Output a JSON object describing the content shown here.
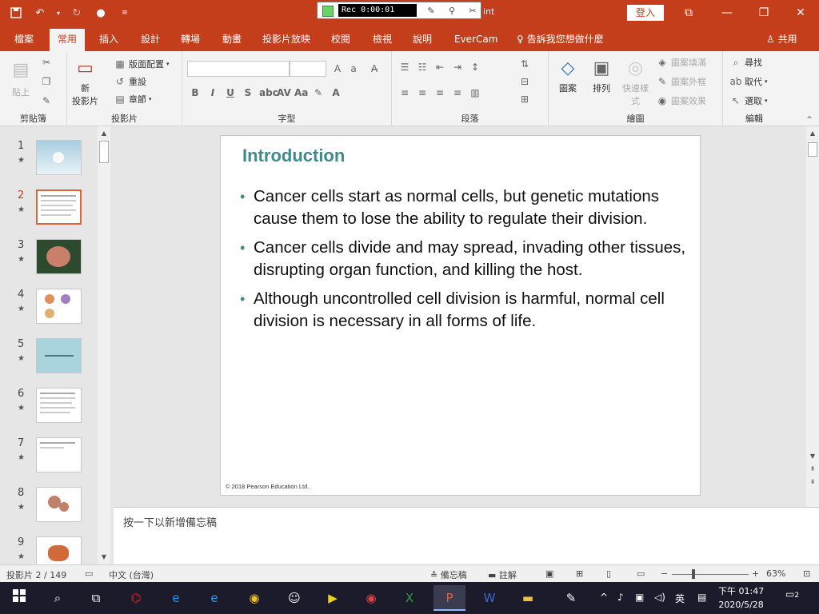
{
  "titlebar": {
    "rec_time": "Rec 0:00:01",
    "app_title": "int",
    "signin_label": "登入",
    "colors": {
      "accent": "#c43e1c"
    }
  },
  "menu": {
    "tabs": [
      "檔案",
      "常用",
      "插入",
      "設計",
      "轉場",
      "動畫",
      "投影片放映",
      "校閱",
      "檢視",
      "說明",
      "EverCam"
    ],
    "active": "常用",
    "tell_me": "告訴我您想做什麼",
    "share": "共用"
  },
  "ribbon": {
    "clipboard": {
      "paste": "貼上",
      "label": "剪貼簿"
    },
    "slides": {
      "new_slide": "新",
      "new_slide_2": "投影片",
      "layout": "版面配置",
      "reset": "重設",
      "section": "章節",
      "label": "投影片"
    },
    "font": {
      "label": "字型"
    },
    "paragraph": {
      "label": "段落"
    },
    "drawing": {
      "shapes": "圖案",
      "arrange": "排列",
      "quick_styles": "快速樣",
      "quick_styles_2": "式",
      "fill": "圖案填滿",
      "outline": "圖案外框",
      "effects": "圖案效果",
      "label": "繪圖"
    },
    "editing": {
      "find": "尋找",
      "replace": "取代",
      "select": "選取",
      "label": "編輯"
    }
  },
  "thumbnails": [
    {
      "num": "1",
      "active": false
    },
    {
      "num": "2",
      "active": true
    },
    {
      "num": "3",
      "active": false
    },
    {
      "num": "4",
      "active": false
    },
    {
      "num": "5",
      "active": false
    },
    {
      "num": "6",
      "active": false
    },
    {
      "num": "7",
      "active": false
    },
    {
      "num": "8",
      "active": false
    },
    {
      "num": "9",
      "active": false
    }
  ],
  "slide": {
    "title": "Introduction",
    "bullets": [
      "Cancer cells start as normal cells, but genetic mutations cause them to lose the ability to regulate their division.",
      "Cancer cells divide and may spread, invading other tissues, disrupting organ function, and killing the host.",
      "Although uncontrolled cell division is harmful, normal cell division is necessary in all forms of life."
    ],
    "copyright": "© 2018 Pearson Education Ltd."
  },
  "notes": {
    "placeholder": "按一下以新增備忘稿"
  },
  "status": {
    "slide_info": "投影片 2 / 149",
    "language": "中文 (台灣)",
    "notes_btn": "備忘稿",
    "comments_btn": "註解",
    "zoom": "63%"
  },
  "taskbar": {
    "time": "下午 01:47",
    "date": "2020/5/28",
    "ime": "英",
    "notif_count": "2"
  }
}
